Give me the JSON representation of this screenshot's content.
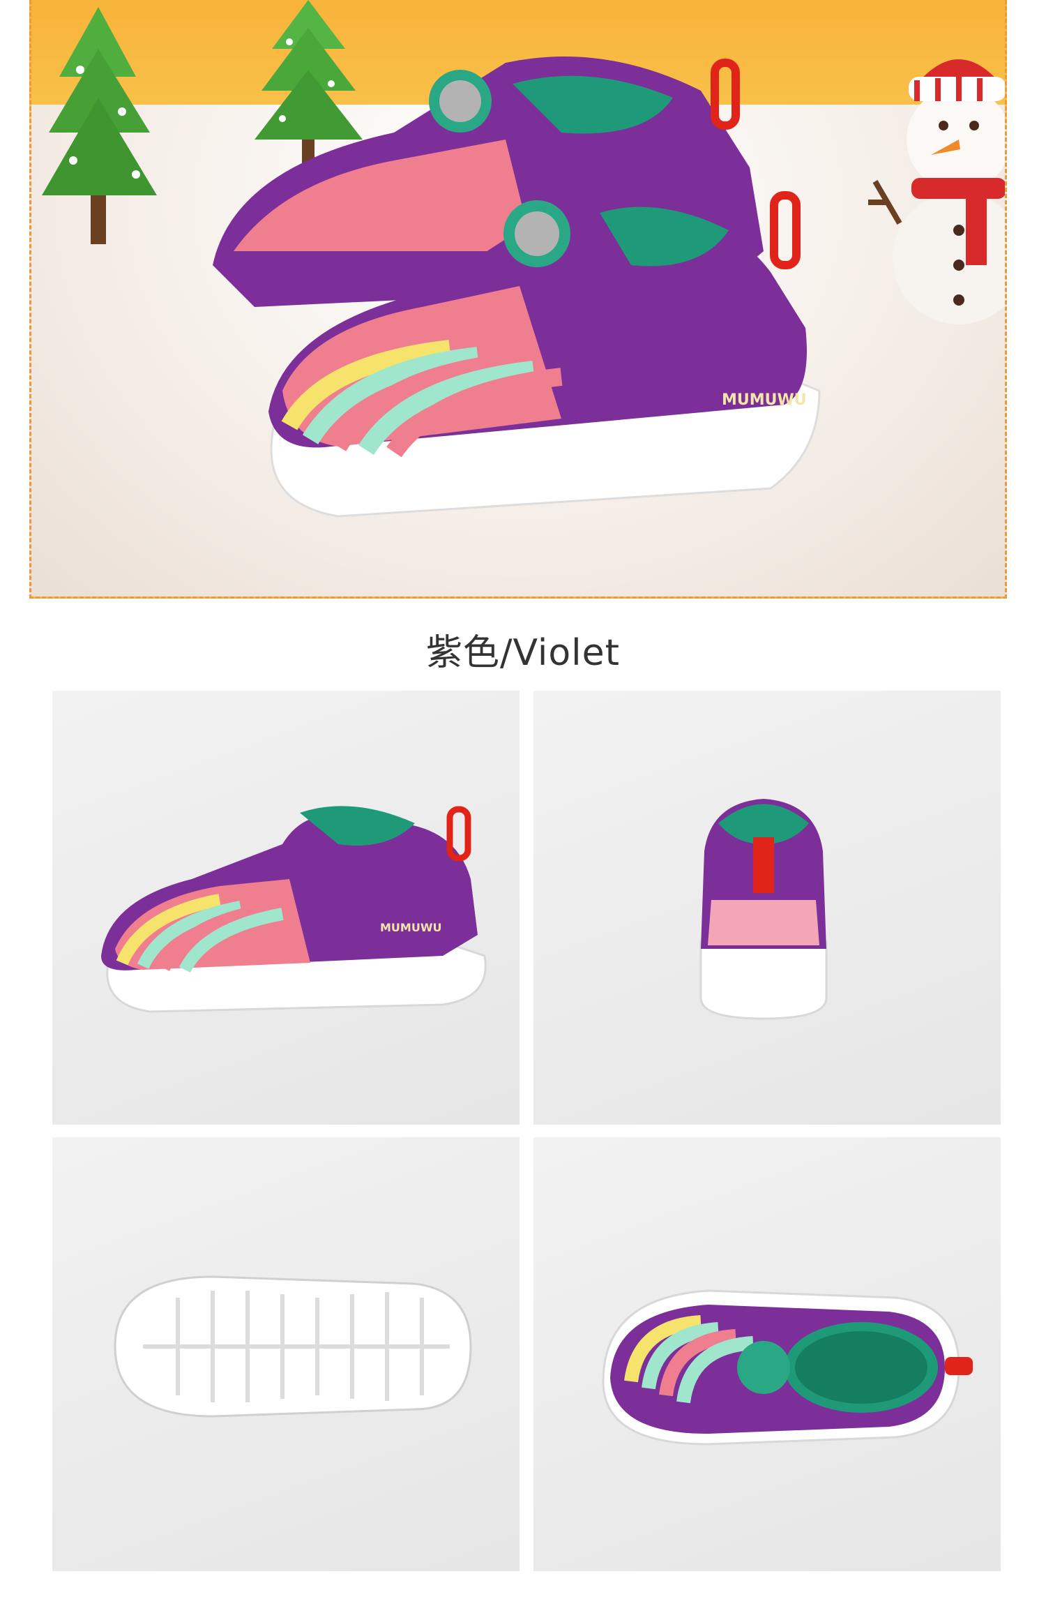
{
  "caption": "紫色/Violet",
  "brand_print": "MUMUWU",
  "colors": {
    "hero_bg": "#f9c14a",
    "hero_border": "#e89a3c",
    "panel_bg": "#ececec",
    "shoe_purple": "#6b2a8c",
    "shoe_pink": "#ef7f8f",
    "shoe_mint": "#9fe6cc",
    "shoe_yellow": "#f5e36b",
    "lining_green": "#1f9a78",
    "tab_red": "#e0241a"
  },
  "panels": [
    {
      "view": "side"
    },
    {
      "view": "back"
    },
    {
      "view": "sole"
    },
    {
      "view": "top"
    }
  ]
}
